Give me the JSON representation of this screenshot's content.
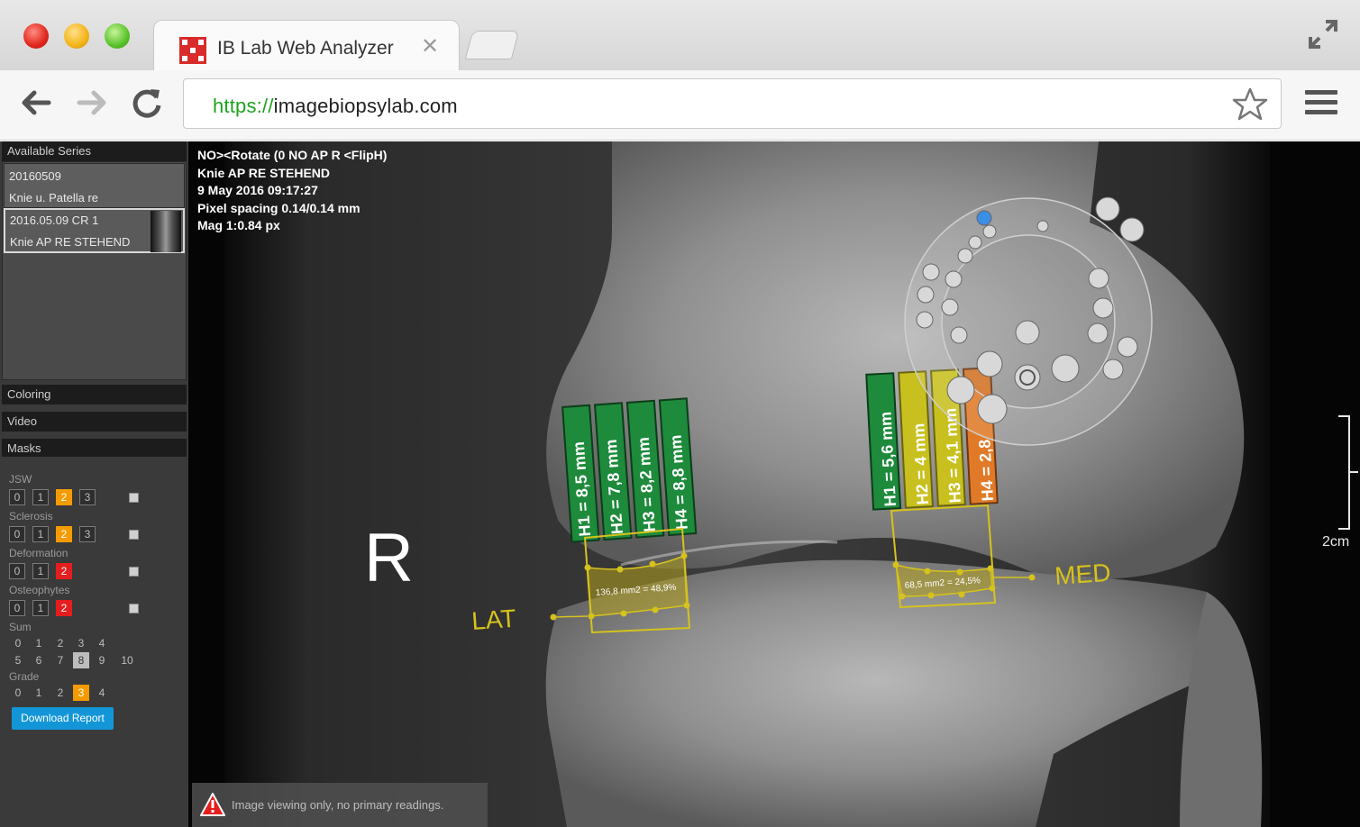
{
  "browser": {
    "tab_title": "IB Lab Web Analyzer",
    "url_protocol": "https://",
    "url_host": "imagebiopsylab.com",
    "icons": [
      "close-icon",
      "expand-icon",
      "back-icon",
      "forward-icon",
      "reload-icon",
      "star-icon",
      "menu-icon"
    ]
  },
  "sidebar": {
    "available_series": "Available Series",
    "series": [
      {
        "line1": "20160509",
        "line2": "Knie u. Patella re"
      },
      {
        "line1": "2016.05.09 CR 1",
        "line2": "Knie AP RE STEHEND"
      }
    ],
    "coloring": "Coloring",
    "video": "Video",
    "masks": "Masks",
    "jsw": {
      "label": "JSW",
      "options": [
        "0",
        "1",
        "2",
        "3"
      ],
      "selected": "2"
    },
    "sclerosis": {
      "label": "Sclerosis",
      "options": [
        "0",
        "1",
        "2",
        "3"
      ],
      "selected": "2"
    },
    "deformation": {
      "label": "Deformation",
      "options": [
        "0",
        "1",
        "2"
      ],
      "selected": "2"
    },
    "osteophytes": {
      "label": "Osteophytes",
      "options": [
        "0",
        "1",
        "2"
      ],
      "selected": "2"
    },
    "sum": {
      "label": "Sum",
      "row1": [
        "0",
        "1",
        "2",
        "3",
        "4"
      ],
      "row2": [
        "5",
        "6",
        "7",
        "8",
        "9",
        "10"
      ],
      "selected": "8"
    },
    "grade": {
      "label": "Grade",
      "options": [
        "0",
        "1",
        "2",
        "3",
        "4"
      ],
      "selected": "3"
    },
    "download_report": "Download Report"
  },
  "viewer": {
    "info": [
      "NO><Rotate (0 NO AP R <FlipH)",
      "Knie AP RE STEHEND",
      "9 May 2016 09:17:27",
      "Pixel spacing 0.14/0.14 mm",
      "Mag 1:0.84 px"
    ],
    "side_marker": "R",
    "lat_label": "LAT",
    "med_label": "MED",
    "scale_label": "2cm",
    "lat_measurements": [
      "H1 = 8,5 mm",
      "H2 = 7,8 mm",
      "H3 = 8,2 mm",
      "H4 = 8,8 mm"
    ],
    "med_measurements": [
      "H1 = 5,6 mm",
      "H2 = 4 mm",
      "H3 = 4,1 mm",
      "H4 = 2,8"
    ],
    "lat_area": "136,8 mm2 = 48,9%",
    "med_area": "68,5 mm2 = 24,5%",
    "warning": "Image viewing only, no primary readings.",
    "colors": {
      "green": "#1e8a3c",
      "yellow": "#c8c01e",
      "orange": "#e07a28",
      "annotation": "#d6c21c"
    }
  }
}
